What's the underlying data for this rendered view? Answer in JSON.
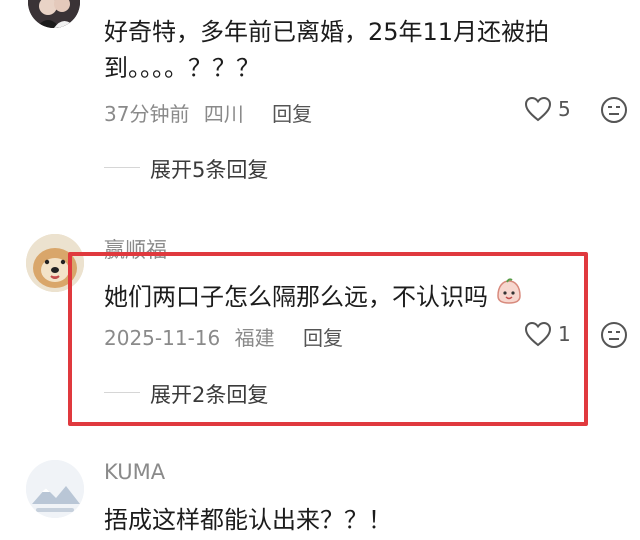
{
  "comments": [
    {
      "text_line1": "好奇特，多年前已离婚，25年11月还被拍",
      "text_line2": "到。。。。？？？",
      "time": "37分钟前",
      "location": "四川",
      "reply_label": "回复",
      "likes": "5",
      "expand_label": "展开5条回复"
    },
    {
      "username": "赢顺福",
      "text": "她们两口子怎么隔那么远，不认识吗",
      "time": "2025-11-16",
      "location": "福建",
      "reply_label": "回复",
      "likes": "1",
      "expand_label": "展开2条回复"
    },
    {
      "username": "KUMA",
      "text": "捂成这样都能认出来？？！"
    }
  ],
  "colors": {
    "highlight": "#e0393e",
    "meta_text": "#8a8a8a"
  }
}
